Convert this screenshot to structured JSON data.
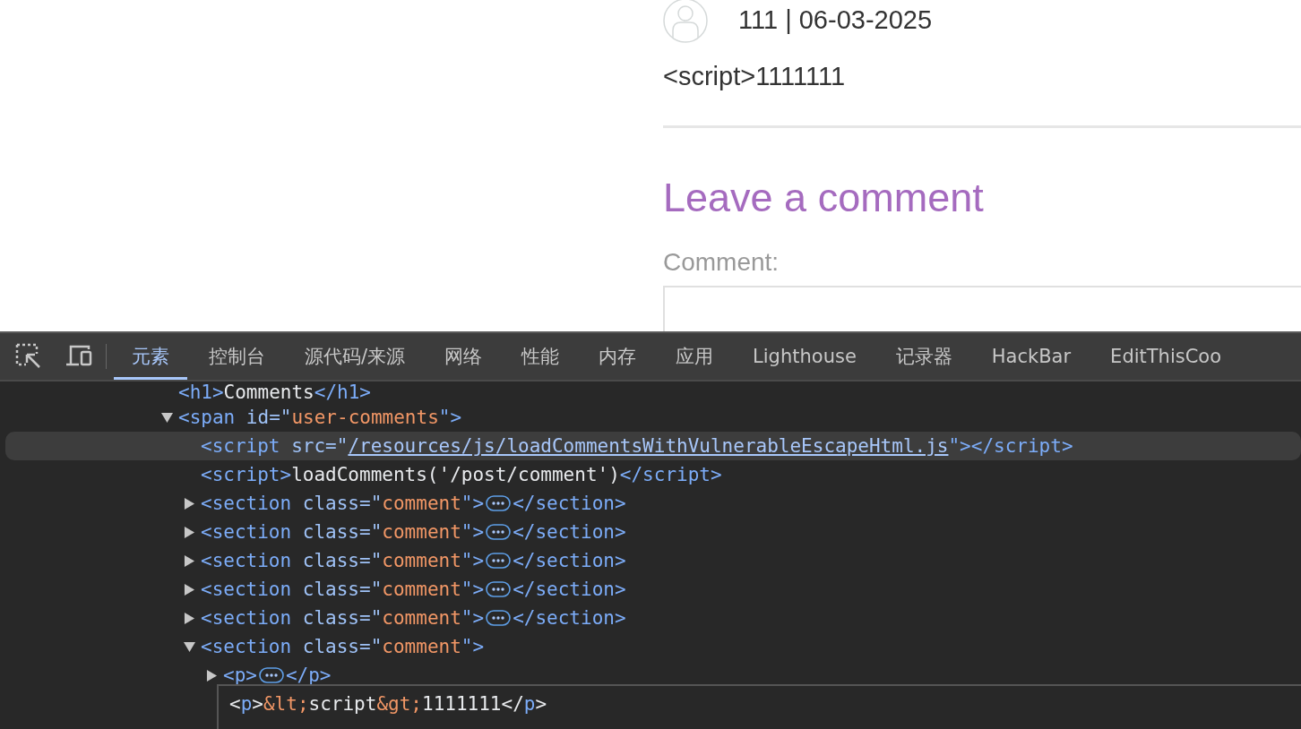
{
  "page": {
    "comment": {
      "meta": "111 | 06-03-2025",
      "body": "<script>1111111"
    },
    "form": {
      "heading": "Leave a comment",
      "label": "Comment:"
    }
  },
  "devtools": {
    "tabs": [
      {
        "label": "元素",
        "selected": true
      },
      {
        "label": "控制台",
        "selected": false
      },
      {
        "label": "源代码/来源",
        "selected": false
      },
      {
        "label": "网络",
        "selected": false
      },
      {
        "label": "性能",
        "selected": false
      },
      {
        "label": "内存",
        "selected": false
      },
      {
        "label": "应用",
        "selected": false
      },
      {
        "label": "Lighthouse",
        "selected": false
      },
      {
        "label": "记录器",
        "selected": false
      },
      {
        "label": "HackBar",
        "selected": false
      },
      {
        "label": "EditThisCoo",
        "selected": false
      }
    ],
    "dom_tree": [
      {
        "selected": false,
        "segments": [
          {
            "kind": "tag",
            "text": "<h1>"
          },
          {
            "kind": "text",
            "text": "Comments"
          },
          {
            "kind": "tag",
            "text": "</h1>"
          }
        ]
      },
      {
        "selected": false,
        "expanded": true,
        "segments": [
          {
            "kind": "tag",
            "text": "<span "
          },
          {
            "kind": "attr",
            "text": "id=\""
          },
          {
            "kind": "value",
            "text": "user-comments"
          },
          {
            "kind": "tag",
            "text": "\">"
          }
        ],
        "children": [
          {
            "selected": true,
            "segments": [
              {
                "kind": "tag",
                "text": "<script "
              },
              {
                "kind": "attr",
                "text": "src=\""
              },
              {
                "kind": "link",
                "text": "/resources/js/loadCommentsWithVulnerableEscapeHtml.js"
              },
              {
                "kind": "tag",
                "text": "\"></script>"
              }
            ]
          },
          {
            "selected": false,
            "segments": [
              {
                "kind": "tag",
                "text": "<script>"
              },
              {
                "kind": "text",
                "text": "loadComments('/post/comment')"
              },
              {
                "kind": "tag",
                "text": "</script>"
              }
            ]
          },
          {
            "selected": false,
            "expanded": false,
            "segments": [
              {
                "kind": "tag",
                "text": "<section "
              },
              {
                "kind": "attr",
                "text": "class=\""
              },
              {
                "kind": "value",
                "text": "comment"
              },
              {
                "kind": "tag",
                "text": "\">"
              },
              {
                "kind": "ellipsis"
              },
              {
                "kind": "tag",
                "text": "</section>"
              }
            ]
          },
          {
            "selected": false,
            "expanded": false,
            "segments": [
              {
                "kind": "tag",
                "text": "<section "
              },
              {
                "kind": "attr",
                "text": "class=\""
              },
              {
                "kind": "value",
                "text": "comment"
              },
              {
                "kind": "tag",
                "text": "\">"
              },
              {
                "kind": "ellipsis"
              },
              {
                "kind": "tag",
                "text": "</section>"
              }
            ]
          },
          {
            "selected": false,
            "expanded": false,
            "segments": [
              {
                "kind": "tag",
                "text": "<section "
              },
              {
                "kind": "attr",
                "text": "class=\""
              },
              {
                "kind": "value",
                "text": "comment"
              },
              {
                "kind": "tag",
                "text": "\">"
              },
              {
                "kind": "ellipsis"
              },
              {
                "kind": "tag",
                "text": "</section>"
              }
            ]
          },
          {
            "selected": false,
            "expanded": false,
            "segments": [
              {
                "kind": "tag",
                "text": "<section "
              },
              {
                "kind": "attr",
                "text": "class=\""
              },
              {
                "kind": "value",
                "text": "comment"
              },
              {
                "kind": "tag",
                "text": "\">"
              },
              {
                "kind": "ellipsis"
              },
              {
                "kind": "tag",
                "text": "</section>"
              }
            ]
          },
          {
            "selected": false,
            "expanded": false,
            "segments": [
              {
                "kind": "tag",
                "text": "<section "
              },
              {
                "kind": "attr",
                "text": "class=\""
              },
              {
                "kind": "value",
                "text": "comment"
              },
              {
                "kind": "tag",
                "text": "\">"
              },
              {
                "kind": "ellipsis"
              },
              {
                "kind": "tag",
                "text": "</section>"
              }
            ]
          },
          {
            "selected": false,
            "expanded": true,
            "segments": [
              {
                "kind": "tag",
                "text": "<section "
              },
              {
                "kind": "attr",
                "text": "class=\""
              },
              {
                "kind": "value",
                "text": "comment"
              },
              {
                "kind": "tag",
                "text": "\">"
              }
            ],
            "children": [
              {
                "selected": false,
                "expanded": false,
                "segments": [
                  {
                    "kind": "tag",
                    "text": "<p>"
                  },
                  {
                    "kind": "ellipsis"
                  },
                  {
                    "kind": "tag",
                    "text": "</p>"
                  }
                ]
              }
            ]
          }
        ]
      }
    ],
    "html_editor": [
      {
        "kind": "punct",
        "text": "<"
      },
      {
        "kind": "tagname",
        "text": "p"
      },
      {
        "kind": "punct",
        "text": ">"
      },
      {
        "kind": "entity",
        "text": "&lt;"
      },
      {
        "kind": "text",
        "text": "script"
      },
      {
        "kind": "entity",
        "text": "&gt;"
      },
      {
        "kind": "text",
        "text": "1111111"
      },
      {
        "kind": "punct",
        "text": "</"
      },
      {
        "kind": "tagname",
        "text": "p"
      },
      {
        "kind": "punct",
        "text": ">"
      }
    ]
  }
}
